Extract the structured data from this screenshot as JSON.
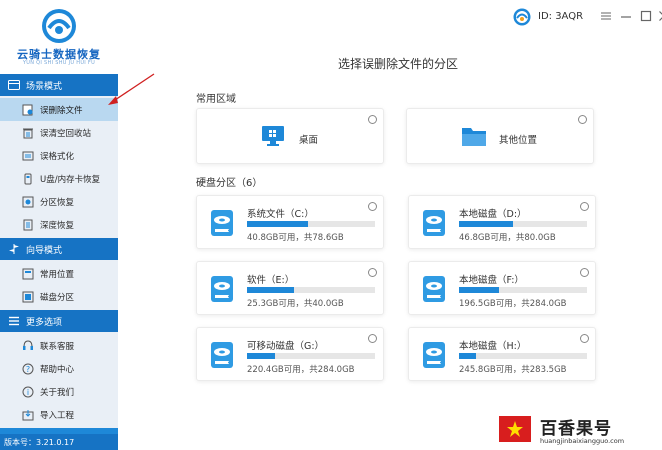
{
  "brand": {
    "name": "云骑士数据恢复",
    "subtitle": "YUN QI SHI SHU JU HUI FU"
  },
  "sidebar": {
    "groups": [
      {
        "title": "场景模式",
        "items": [
          "误删除文件",
          "误清空回收站",
          "误格式化",
          "U盘/内存卡恢复",
          "分区恢复",
          "深度恢复"
        ]
      },
      {
        "title": "向导模式",
        "items": [
          "常用位置",
          "磁盘分区"
        ]
      },
      {
        "title": "更多选项",
        "items": [
          "联系客服",
          "帮助中心",
          "关于我们",
          "导入工程"
        ]
      }
    ],
    "active_item": "误删除文件",
    "version": "版本号：3.21.0.17"
  },
  "header": {
    "user_id": "ID: 3AQR"
  },
  "main": {
    "title": "选择误删除文件的分区",
    "common_label": "常用区域",
    "common": [
      {
        "name": "桌面",
        "icon": "desktop-icon"
      },
      {
        "name": "其他位置",
        "icon": "folder-icon"
      }
    ],
    "disk_label": "硬盘分区（6）",
    "disks": [
      {
        "name": "系统文件（C:）",
        "info": "40.8GB可用，共78.6GB",
        "used_fraction": 0.48
      },
      {
        "name": "本地磁盘（D:）",
        "info": "46.8GB可用，共80.0GB",
        "used_fraction": 0.42
      },
      {
        "name": "软件（E:）",
        "info": "25.3GB可用，共40.0GB",
        "used_fraction": 0.37
      },
      {
        "name": "本地磁盘（F:）",
        "info": "196.5GB可用，共284.0GB",
        "used_fraction": 0.31
      },
      {
        "name": "可移动磁盘（G:）",
        "info": "220.4GB可用，共284.0GB",
        "used_fraction": 0.22
      },
      {
        "name": "本地磁盘（H:）",
        "info": "245.8GB可用，共283.5GB",
        "used_fraction": 0.13
      }
    ]
  },
  "watermark": {
    "title": "百香果号",
    "url": "huangjinbaixiangguo.com"
  },
  "colors": {
    "accent": "#1e88d8",
    "sidebar_dark": "#1673c4",
    "active_item": "#b9d8f0"
  }
}
